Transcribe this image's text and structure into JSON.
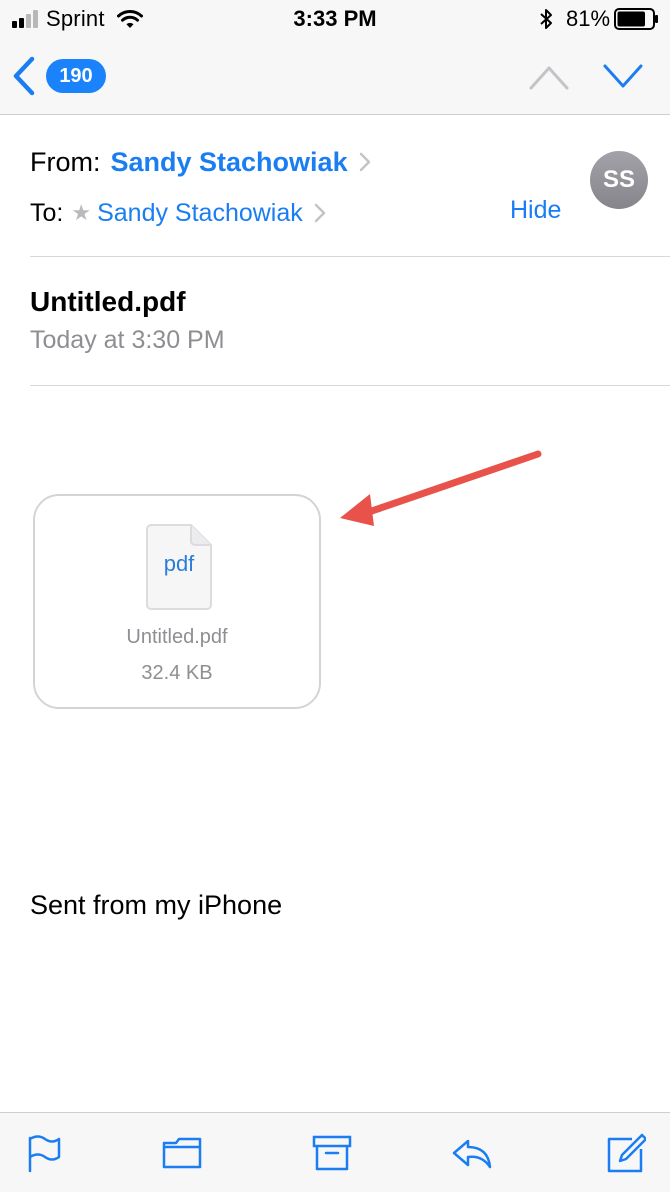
{
  "status_bar": {
    "carrier": "Sprint",
    "time": "3:33 PM",
    "battery_percent": "81%",
    "battery_level": 0.81,
    "signal_bars": 2,
    "signal_bars_total": 4
  },
  "nav": {
    "unread_count": "190"
  },
  "header": {
    "from_label": "From:",
    "from_name": "Sandy Stachowiak",
    "to_label": "To:",
    "to_name": "Sandy Stachowiak",
    "hide_label": "Hide",
    "avatar_initials": "SS"
  },
  "message": {
    "subject": "Untitled.pdf",
    "date": "Today at 3:30 PM",
    "signature": "Sent from my iPhone"
  },
  "attachment": {
    "file_type": "pdf",
    "file_name": "Untitled.pdf",
    "file_size": "32.4 KB"
  },
  "toolbar": {
    "items": [
      "flag-icon",
      "folder-icon",
      "archive-icon",
      "reply-icon",
      "compose-icon"
    ]
  },
  "colors": {
    "accent": "#1a7ef2",
    "annotation_arrow": "#e8524a",
    "secondary_text": "#8e8e93"
  }
}
